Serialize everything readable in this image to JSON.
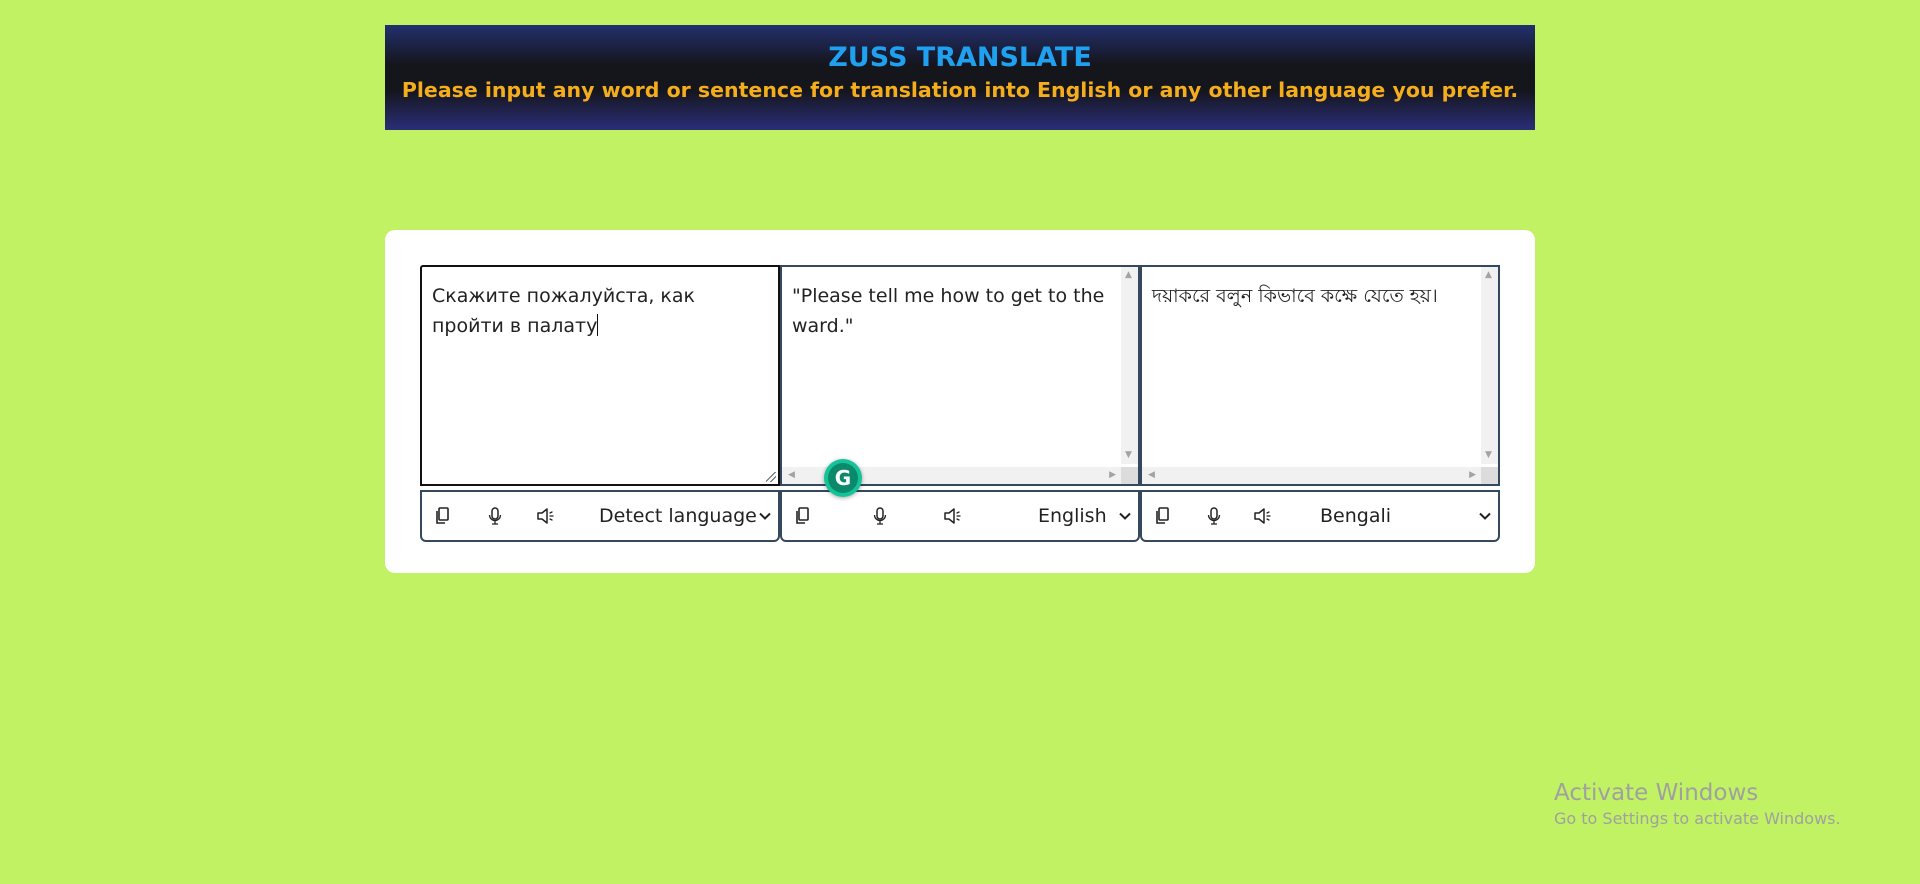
{
  "header": {
    "title": "ZUSS TRANSLATE",
    "subtitle": "Please input any word or sentence for translation into English or any other language you prefer."
  },
  "panels": [
    {
      "text": "Скажите пожалуйста, как пройти в палату",
      "language": "Detect language",
      "icons": [
        "copy-icon",
        "microphone-icon",
        "speaker-icon"
      ]
    },
    {
      "text": "\"Please tell me how to get to the ward.\"",
      "language": "English",
      "icons": [
        "copy-icon",
        "microphone-icon",
        "speaker-icon"
      ]
    },
    {
      "text": "দয়াকরে বলুন কিভাবে কক্ষে যেতে হয়।",
      "language": "Bengali",
      "icons": [
        "copy-icon",
        "microphone-icon",
        "speaker-icon"
      ]
    }
  ],
  "grammarly": {
    "label": "G"
  },
  "watermark": {
    "title": "Activate Windows",
    "subtitle": "Go to Settings to activate Windows."
  },
  "colors": {
    "background": "#c1f264",
    "header_title": "#1fa1f0",
    "header_subtitle": "#f4ad1d",
    "border": "#34495e",
    "grammarly": "#15c39a"
  }
}
